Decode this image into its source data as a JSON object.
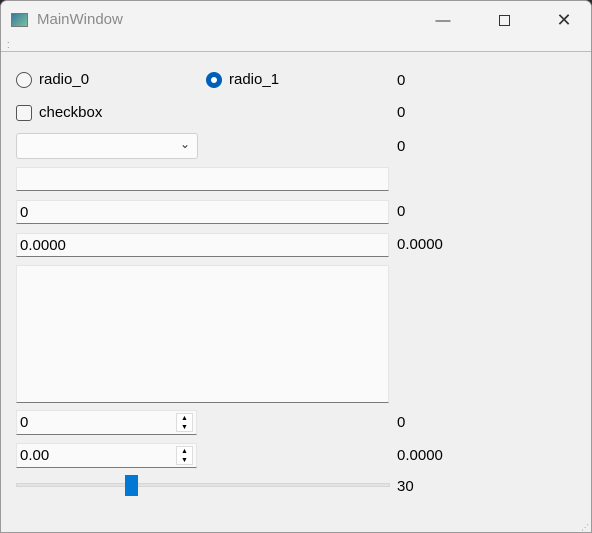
{
  "window": {
    "title": "MainWindow",
    "icon": "app-window-icon",
    "minimize_icon": "minimize-icon",
    "maximize_icon": "maximize-icon",
    "close_icon": "close-icon"
  },
  "radio_0": {
    "label": "radio_0",
    "checked": false
  },
  "radio_1": {
    "label": "radio_1",
    "checked": true
  },
  "radio_value": "0",
  "checkbox": {
    "label": "checkbox",
    "checked": false
  },
  "checkbox_value": "0",
  "combo": {
    "value": "",
    "output": "0"
  },
  "line_edit": {
    "value": ""
  },
  "int_edit": {
    "value": "0",
    "output": "0"
  },
  "float_edit": {
    "value": "0.0000",
    "output": "0.0000"
  },
  "text_edit": {
    "value": ""
  },
  "spin_box": {
    "value": "0",
    "output": "0"
  },
  "double_spin_box": {
    "value": "0.00",
    "output": "0.0000"
  },
  "slider": {
    "value": 30,
    "min": 0,
    "max": 99,
    "output": "30"
  },
  "accent": "#005fb8"
}
